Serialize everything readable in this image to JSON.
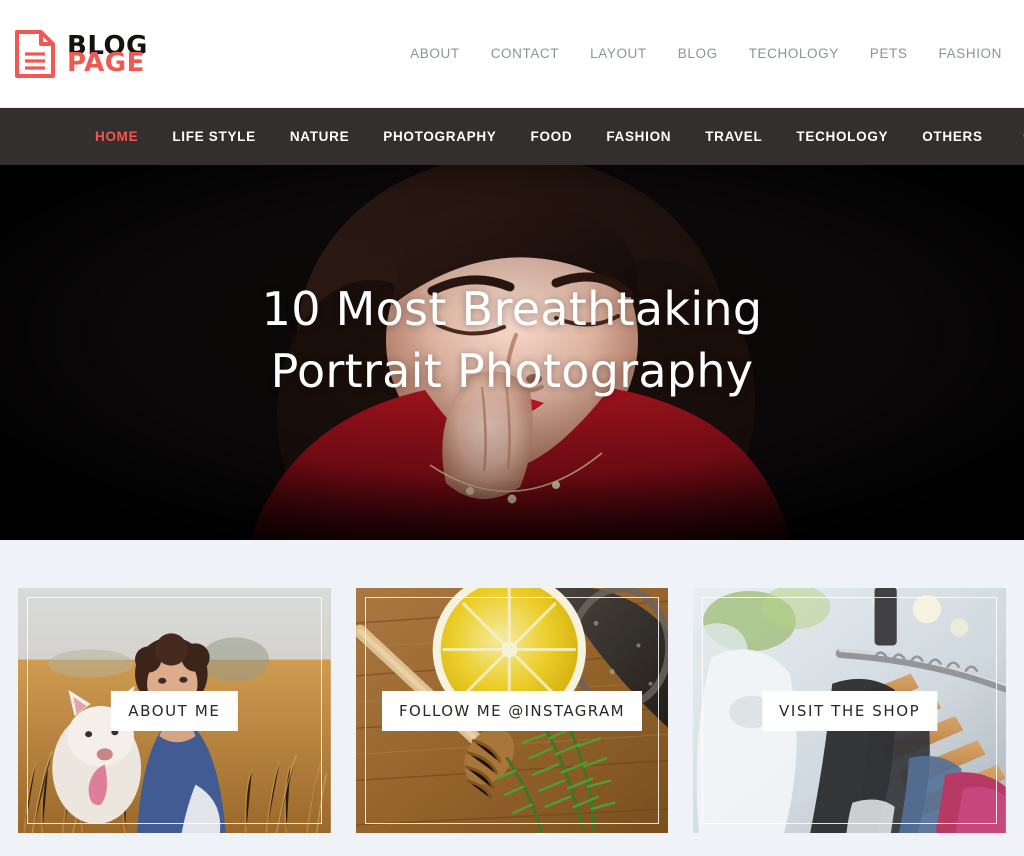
{
  "header": {
    "brand": {
      "icon": "document-icon",
      "line1": "BLOG",
      "line2": "PAGE"
    },
    "nav": [
      {
        "label": "ABOUT"
      },
      {
        "label": "CONTACT"
      },
      {
        "label": "LAYOUT"
      },
      {
        "label": "BLOG"
      },
      {
        "label": "TECHOLOGY"
      },
      {
        "label": "PETS"
      },
      {
        "label": "FASHION"
      }
    ]
  },
  "main_nav": {
    "items": [
      {
        "label": "HOME",
        "active": true
      },
      {
        "label": "LIFE STYLE",
        "active": false
      },
      {
        "label": "NATURE",
        "active": false
      },
      {
        "label": "PHOTOGRAPHY",
        "active": false
      },
      {
        "label": "FOOD",
        "active": false
      },
      {
        "label": "FASHION",
        "active": false
      },
      {
        "label": "TRAVEL",
        "active": false
      },
      {
        "label": "TECHOLOGY",
        "active": false
      },
      {
        "label": "OTHERS",
        "active": false
      }
    ],
    "search_icon": "search-icon"
  },
  "hero": {
    "title_line1": "10 Most Breathtaking",
    "title_line2": "Portrait Photography",
    "image_alt": "woman-in-red-dress-portrait"
  },
  "promos": [
    {
      "badge": "ABOUT ME",
      "image_alt": "girl-with-white-dog-in-wheat-field"
    },
    {
      "badge": "FOLLOW ME @INSTAGRAM",
      "image_alt": "lemon-slice-honey-dipper-rosemary"
    },
    {
      "badge": "VISIT THE SHOP",
      "image_alt": "clothing-rack-with-wooden-hangers"
    }
  ],
  "colors": {
    "accent": "#f2584f",
    "nav_bar": "#332f2e",
    "promo_bg": "#eff3f8",
    "top_nav_text": "#8d939c",
    "hero_bg": "#0d0a0a"
  }
}
